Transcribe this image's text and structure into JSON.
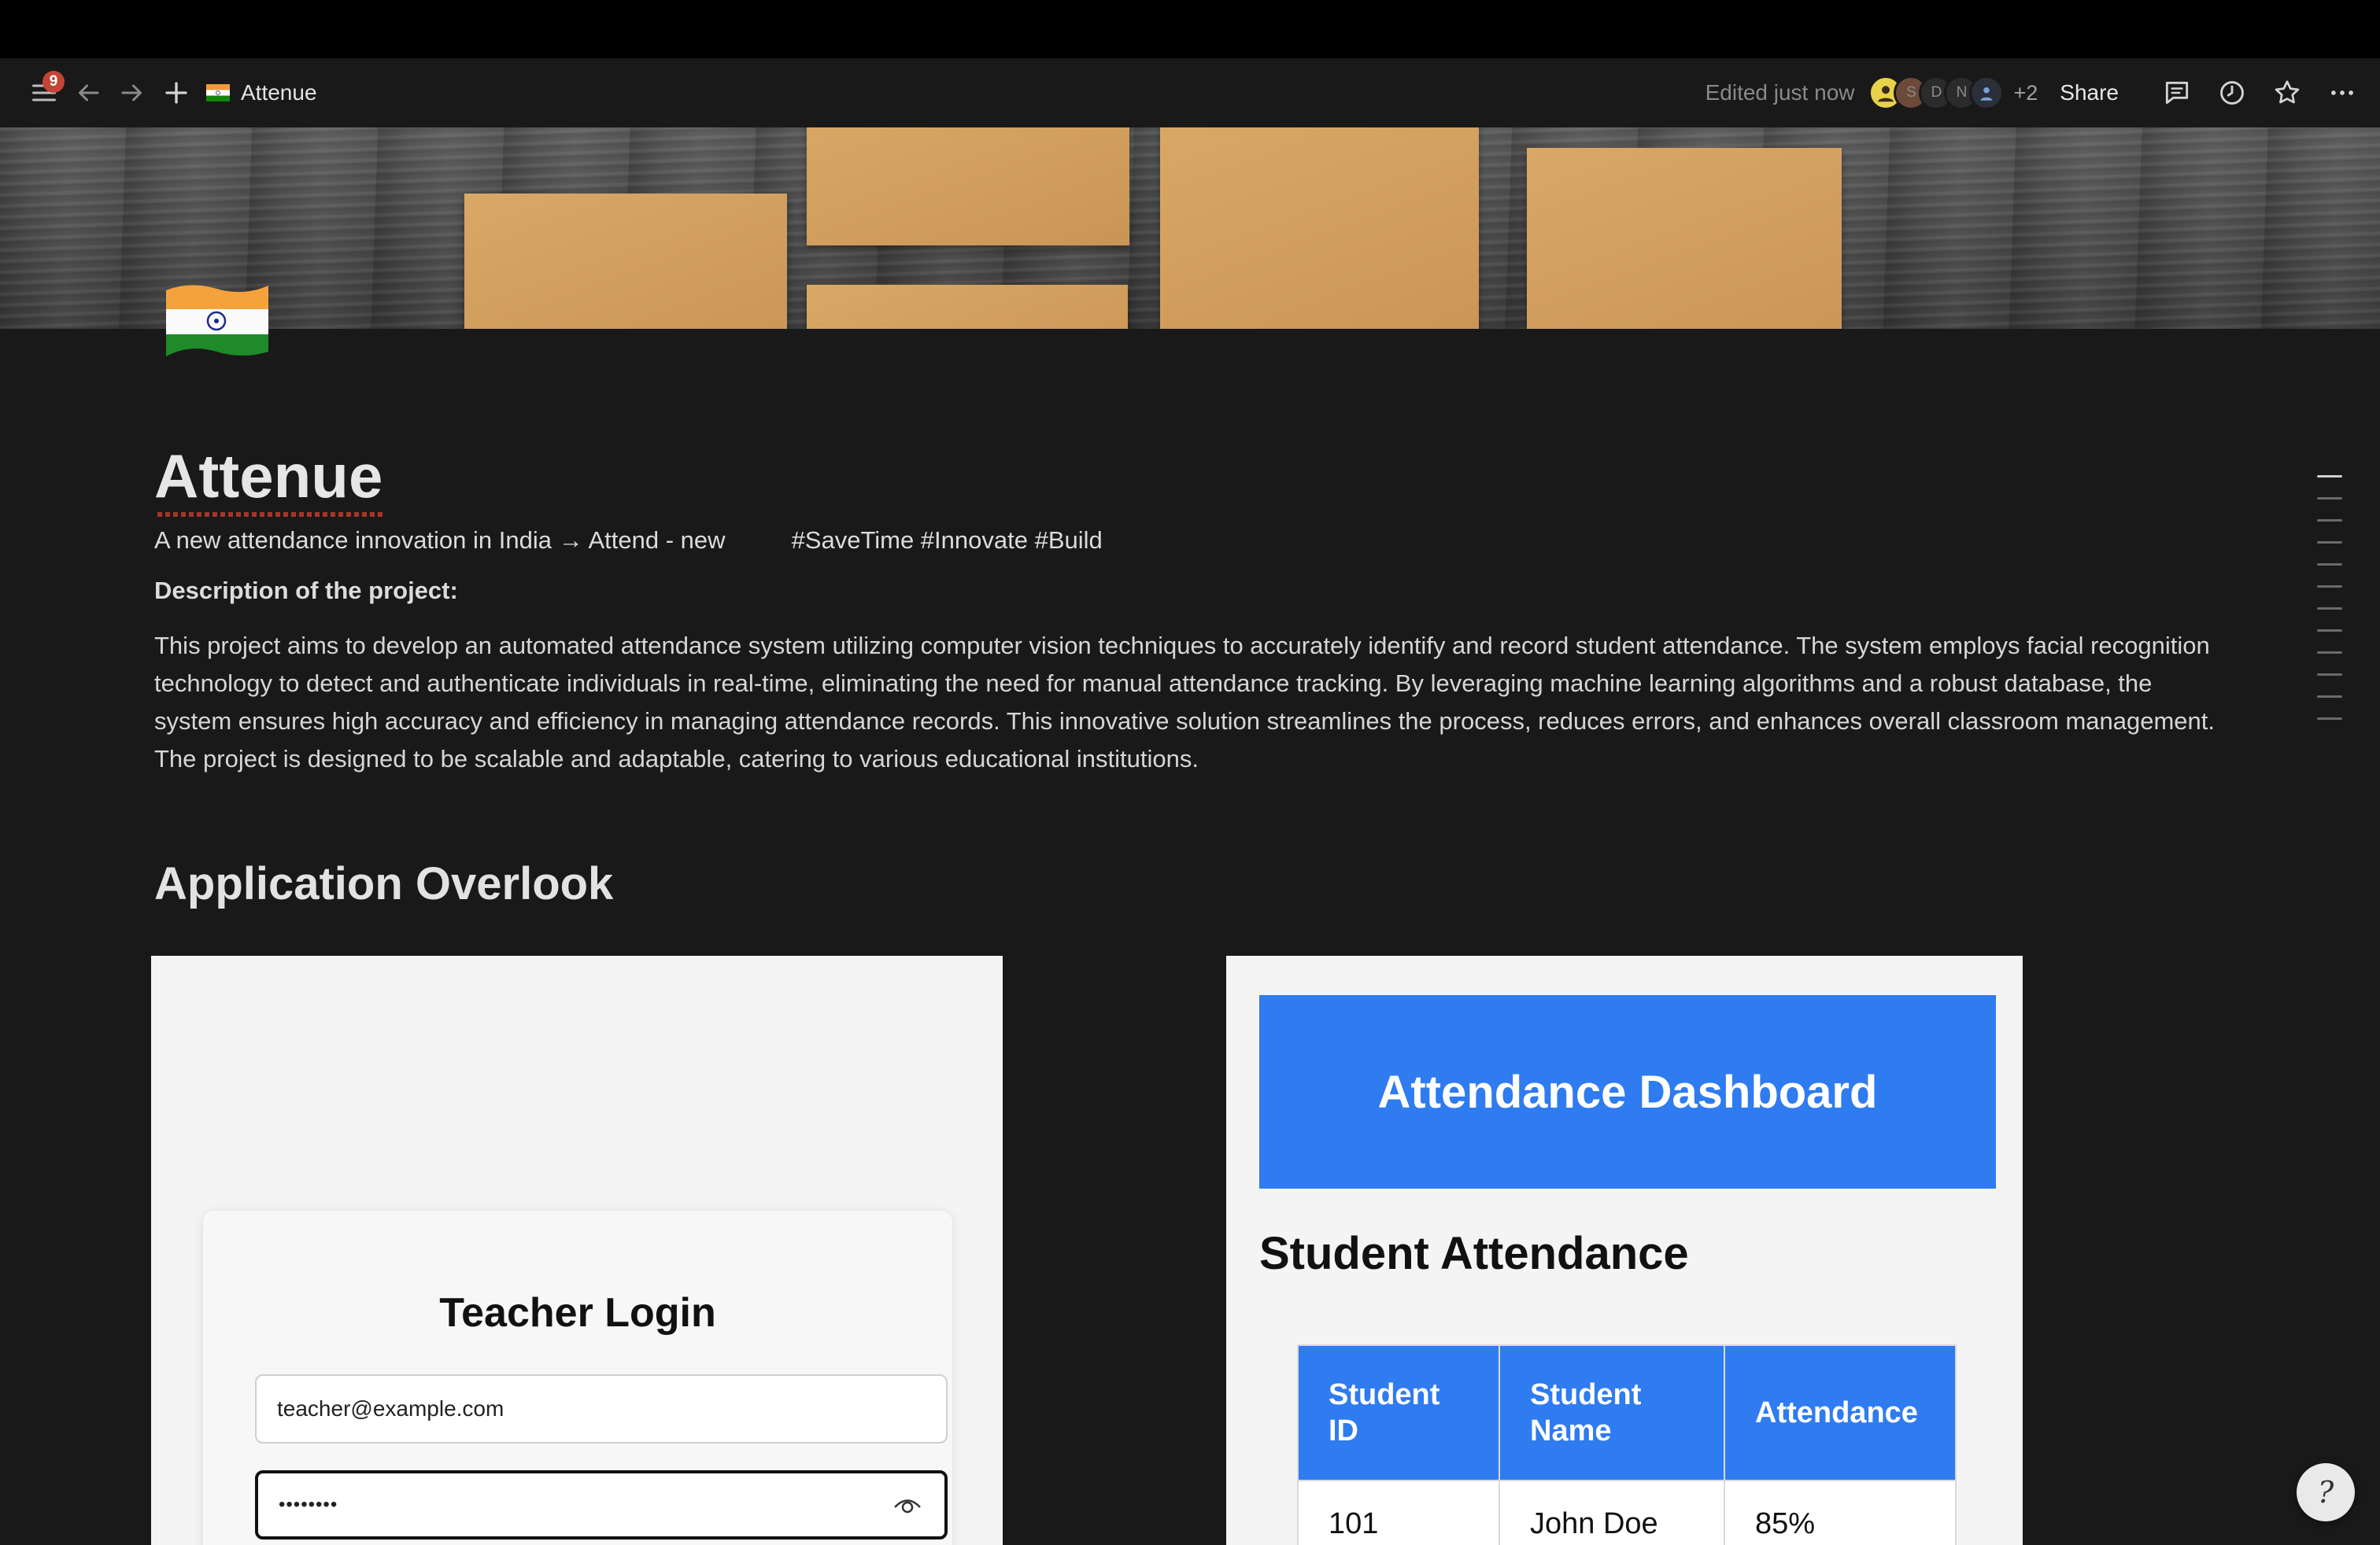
{
  "topbar": {
    "notification_count": "9",
    "breadcrumb_title": "Attenue",
    "edited_status": "Edited just now",
    "avatars": [
      "S",
      "D",
      "N"
    ],
    "more_collaborators": "+2",
    "share_label": "Share"
  },
  "page": {
    "title": "Attenue",
    "subtitle_left": "A new attendance innovation in India → Attend - new",
    "subtitle_tags": "#SaveTime #Innovate #Build",
    "description_heading": "Description of the project:",
    "description": "This project aims to develop an automated attendance system utilizing computer vision techniques to accurately identify and record student attendance. The system employs facial recognition technology to detect and authenticate individuals in real-time, eliminating the need for manual attendance tracking. By leveraging machine learning algorithms and a robust database, the system ensures high accuracy and efficiency in managing attendance records. This innovative solution streamlines the process, reduces errors, and enhances overall classroom management. The project is designed to be scalable and adaptable, catering to various educational institutions.",
    "section_heading": "Application Overlook"
  },
  "login_screenshot": {
    "title": "Teacher Login",
    "email_value": "teacher@example.com",
    "password_value": "••••••••"
  },
  "dashboard_screenshot": {
    "banner": "Attendance Dashboard",
    "heading": "Student Attendance",
    "columns": [
      "Student ID",
      "Student Name",
      "Attendance"
    ],
    "rows": [
      [
        "101",
        "John Doe",
        "85%"
      ]
    ]
  },
  "help_button": "?",
  "colors": {
    "background": "#191919",
    "accent_blue": "#2f7bf0",
    "badge_red": "#c44536"
  }
}
